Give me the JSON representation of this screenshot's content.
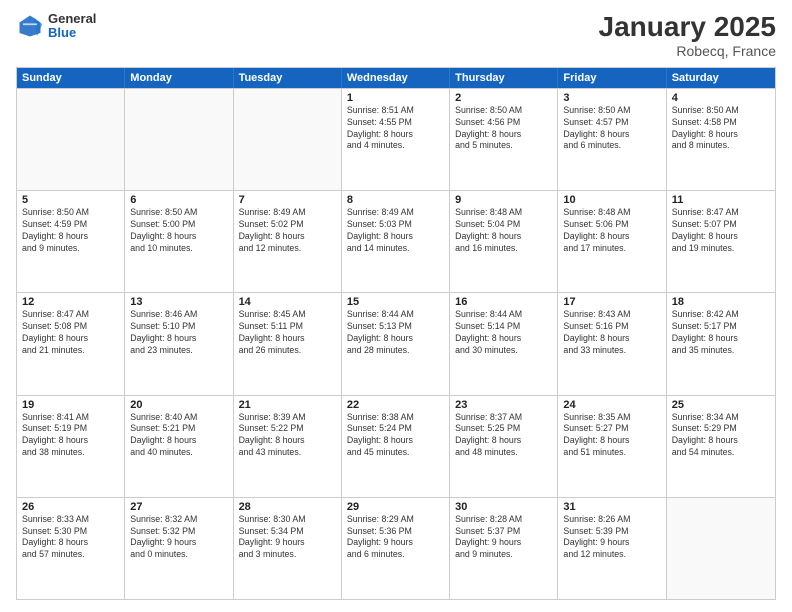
{
  "logo": {
    "general": "General",
    "blue": "Blue"
  },
  "header": {
    "title": "January 2025",
    "location": "Robecq, France"
  },
  "weekdays": [
    "Sunday",
    "Monday",
    "Tuesday",
    "Wednesday",
    "Thursday",
    "Friday",
    "Saturday"
  ],
  "weeks": [
    [
      {
        "day": "",
        "text": ""
      },
      {
        "day": "",
        "text": ""
      },
      {
        "day": "",
        "text": ""
      },
      {
        "day": "1",
        "text": "Sunrise: 8:51 AM\nSunset: 4:55 PM\nDaylight: 8 hours\nand 4 minutes."
      },
      {
        "day": "2",
        "text": "Sunrise: 8:50 AM\nSunset: 4:56 PM\nDaylight: 8 hours\nand 5 minutes."
      },
      {
        "day": "3",
        "text": "Sunrise: 8:50 AM\nSunset: 4:57 PM\nDaylight: 8 hours\nand 6 minutes."
      },
      {
        "day": "4",
        "text": "Sunrise: 8:50 AM\nSunset: 4:58 PM\nDaylight: 8 hours\nand 8 minutes."
      }
    ],
    [
      {
        "day": "5",
        "text": "Sunrise: 8:50 AM\nSunset: 4:59 PM\nDaylight: 8 hours\nand 9 minutes."
      },
      {
        "day": "6",
        "text": "Sunrise: 8:50 AM\nSunset: 5:00 PM\nDaylight: 8 hours\nand 10 minutes."
      },
      {
        "day": "7",
        "text": "Sunrise: 8:49 AM\nSunset: 5:02 PM\nDaylight: 8 hours\nand 12 minutes."
      },
      {
        "day": "8",
        "text": "Sunrise: 8:49 AM\nSunset: 5:03 PM\nDaylight: 8 hours\nand 14 minutes."
      },
      {
        "day": "9",
        "text": "Sunrise: 8:48 AM\nSunset: 5:04 PM\nDaylight: 8 hours\nand 16 minutes."
      },
      {
        "day": "10",
        "text": "Sunrise: 8:48 AM\nSunset: 5:06 PM\nDaylight: 8 hours\nand 17 minutes."
      },
      {
        "day": "11",
        "text": "Sunrise: 8:47 AM\nSunset: 5:07 PM\nDaylight: 8 hours\nand 19 minutes."
      }
    ],
    [
      {
        "day": "12",
        "text": "Sunrise: 8:47 AM\nSunset: 5:08 PM\nDaylight: 8 hours\nand 21 minutes."
      },
      {
        "day": "13",
        "text": "Sunrise: 8:46 AM\nSunset: 5:10 PM\nDaylight: 8 hours\nand 23 minutes."
      },
      {
        "day": "14",
        "text": "Sunrise: 8:45 AM\nSunset: 5:11 PM\nDaylight: 8 hours\nand 26 minutes."
      },
      {
        "day": "15",
        "text": "Sunrise: 8:44 AM\nSunset: 5:13 PM\nDaylight: 8 hours\nand 28 minutes."
      },
      {
        "day": "16",
        "text": "Sunrise: 8:44 AM\nSunset: 5:14 PM\nDaylight: 8 hours\nand 30 minutes."
      },
      {
        "day": "17",
        "text": "Sunrise: 8:43 AM\nSunset: 5:16 PM\nDaylight: 8 hours\nand 33 minutes."
      },
      {
        "day": "18",
        "text": "Sunrise: 8:42 AM\nSunset: 5:17 PM\nDaylight: 8 hours\nand 35 minutes."
      }
    ],
    [
      {
        "day": "19",
        "text": "Sunrise: 8:41 AM\nSunset: 5:19 PM\nDaylight: 8 hours\nand 38 minutes."
      },
      {
        "day": "20",
        "text": "Sunrise: 8:40 AM\nSunset: 5:21 PM\nDaylight: 8 hours\nand 40 minutes."
      },
      {
        "day": "21",
        "text": "Sunrise: 8:39 AM\nSunset: 5:22 PM\nDaylight: 8 hours\nand 43 minutes."
      },
      {
        "day": "22",
        "text": "Sunrise: 8:38 AM\nSunset: 5:24 PM\nDaylight: 8 hours\nand 45 minutes."
      },
      {
        "day": "23",
        "text": "Sunrise: 8:37 AM\nSunset: 5:25 PM\nDaylight: 8 hours\nand 48 minutes."
      },
      {
        "day": "24",
        "text": "Sunrise: 8:35 AM\nSunset: 5:27 PM\nDaylight: 8 hours\nand 51 minutes."
      },
      {
        "day": "25",
        "text": "Sunrise: 8:34 AM\nSunset: 5:29 PM\nDaylight: 8 hours\nand 54 minutes."
      }
    ],
    [
      {
        "day": "26",
        "text": "Sunrise: 8:33 AM\nSunset: 5:30 PM\nDaylight: 8 hours\nand 57 minutes."
      },
      {
        "day": "27",
        "text": "Sunrise: 8:32 AM\nSunset: 5:32 PM\nDaylight: 9 hours\nand 0 minutes."
      },
      {
        "day": "28",
        "text": "Sunrise: 8:30 AM\nSunset: 5:34 PM\nDaylight: 9 hours\nand 3 minutes."
      },
      {
        "day": "29",
        "text": "Sunrise: 8:29 AM\nSunset: 5:36 PM\nDaylight: 9 hours\nand 6 minutes."
      },
      {
        "day": "30",
        "text": "Sunrise: 8:28 AM\nSunset: 5:37 PM\nDaylight: 9 hours\nand 9 minutes."
      },
      {
        "day": "31",
        "text": "Sunrise: 8:26 AM\nSunset: 5:39 PM\nDaylight: 9 hours\nand 12 minutes."
      },
      {
        "day": "",
        "text": ""
      }
    ]
  ]
}
